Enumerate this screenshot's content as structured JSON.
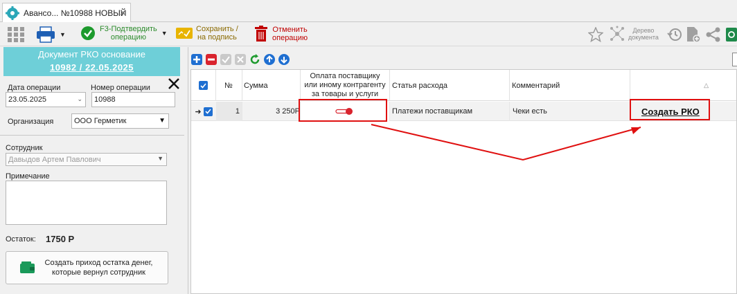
{
  "tab": {
    "title": "Авансо... №10988 НОВЫЙ",
    "close": "✕"
  },
  "toolbar": {
    "confirm_line1": "F3-Подтвердить",
    "confirm_line2": "операцию",
    "save_line1": "Сохранить /",
    "save_line2": "на подпись",
    "cancel_line1": "Отменить",
    "cancel_line2": "операцию",
    "tree_line1": "Дерево",
    "tree_line2": "документа"
  },
  "left": {
    "doc_title": "Документ РКО основание",
    "doc_ref": "10982 / 22.05.2025",
    "date_label": "Дата операции",
    "date_value": "23.05.2025",
    "number_label": "Номер операции",
    "number_value": "10988",
    "org_label": "Организация",
    "org_value": "ООО Герметик",
    "employee_label": "Сотрудник",
    "employee_value": "Давыдов Артем Павлович",
    "note_label": "Примечание",
    "note_value": "",
    "balance_label": "Остаток:",
    "balance_value": "1750 Р",
    "create_btn_line1": "Создать приход остатка денег,",
    "create_btn_line2": "которые вернул сотрудник"
  },
  "table": {
    "headers": {
      "num": "№",
      "sum": "Сумма",
      "pay_line1": "Оплата поставщику",
      "pay_line2": "или иному контрагенту",
      "pay_line3": "за товары и услуги",
      "article": "Статья расхода",
      "comment": "Комментарий",
      "sort": "△"
    },
    "rows": [
      {
        "num": "1",
        "sum": "3 250Р",
        "article": "Платежи поставщикам",
        "comment": "Чеки есть",
        "action": "Создать РКО",
        "payment_toggle_on": true
      }
    ]
  },
  "colors": {
    "header_bg": "#6ecfd8",
    "accent_blue": "#1f6fd1",
    "highlight_red": "#e01010",
    "confirm_green": "#2a8a2a"
  }
}
